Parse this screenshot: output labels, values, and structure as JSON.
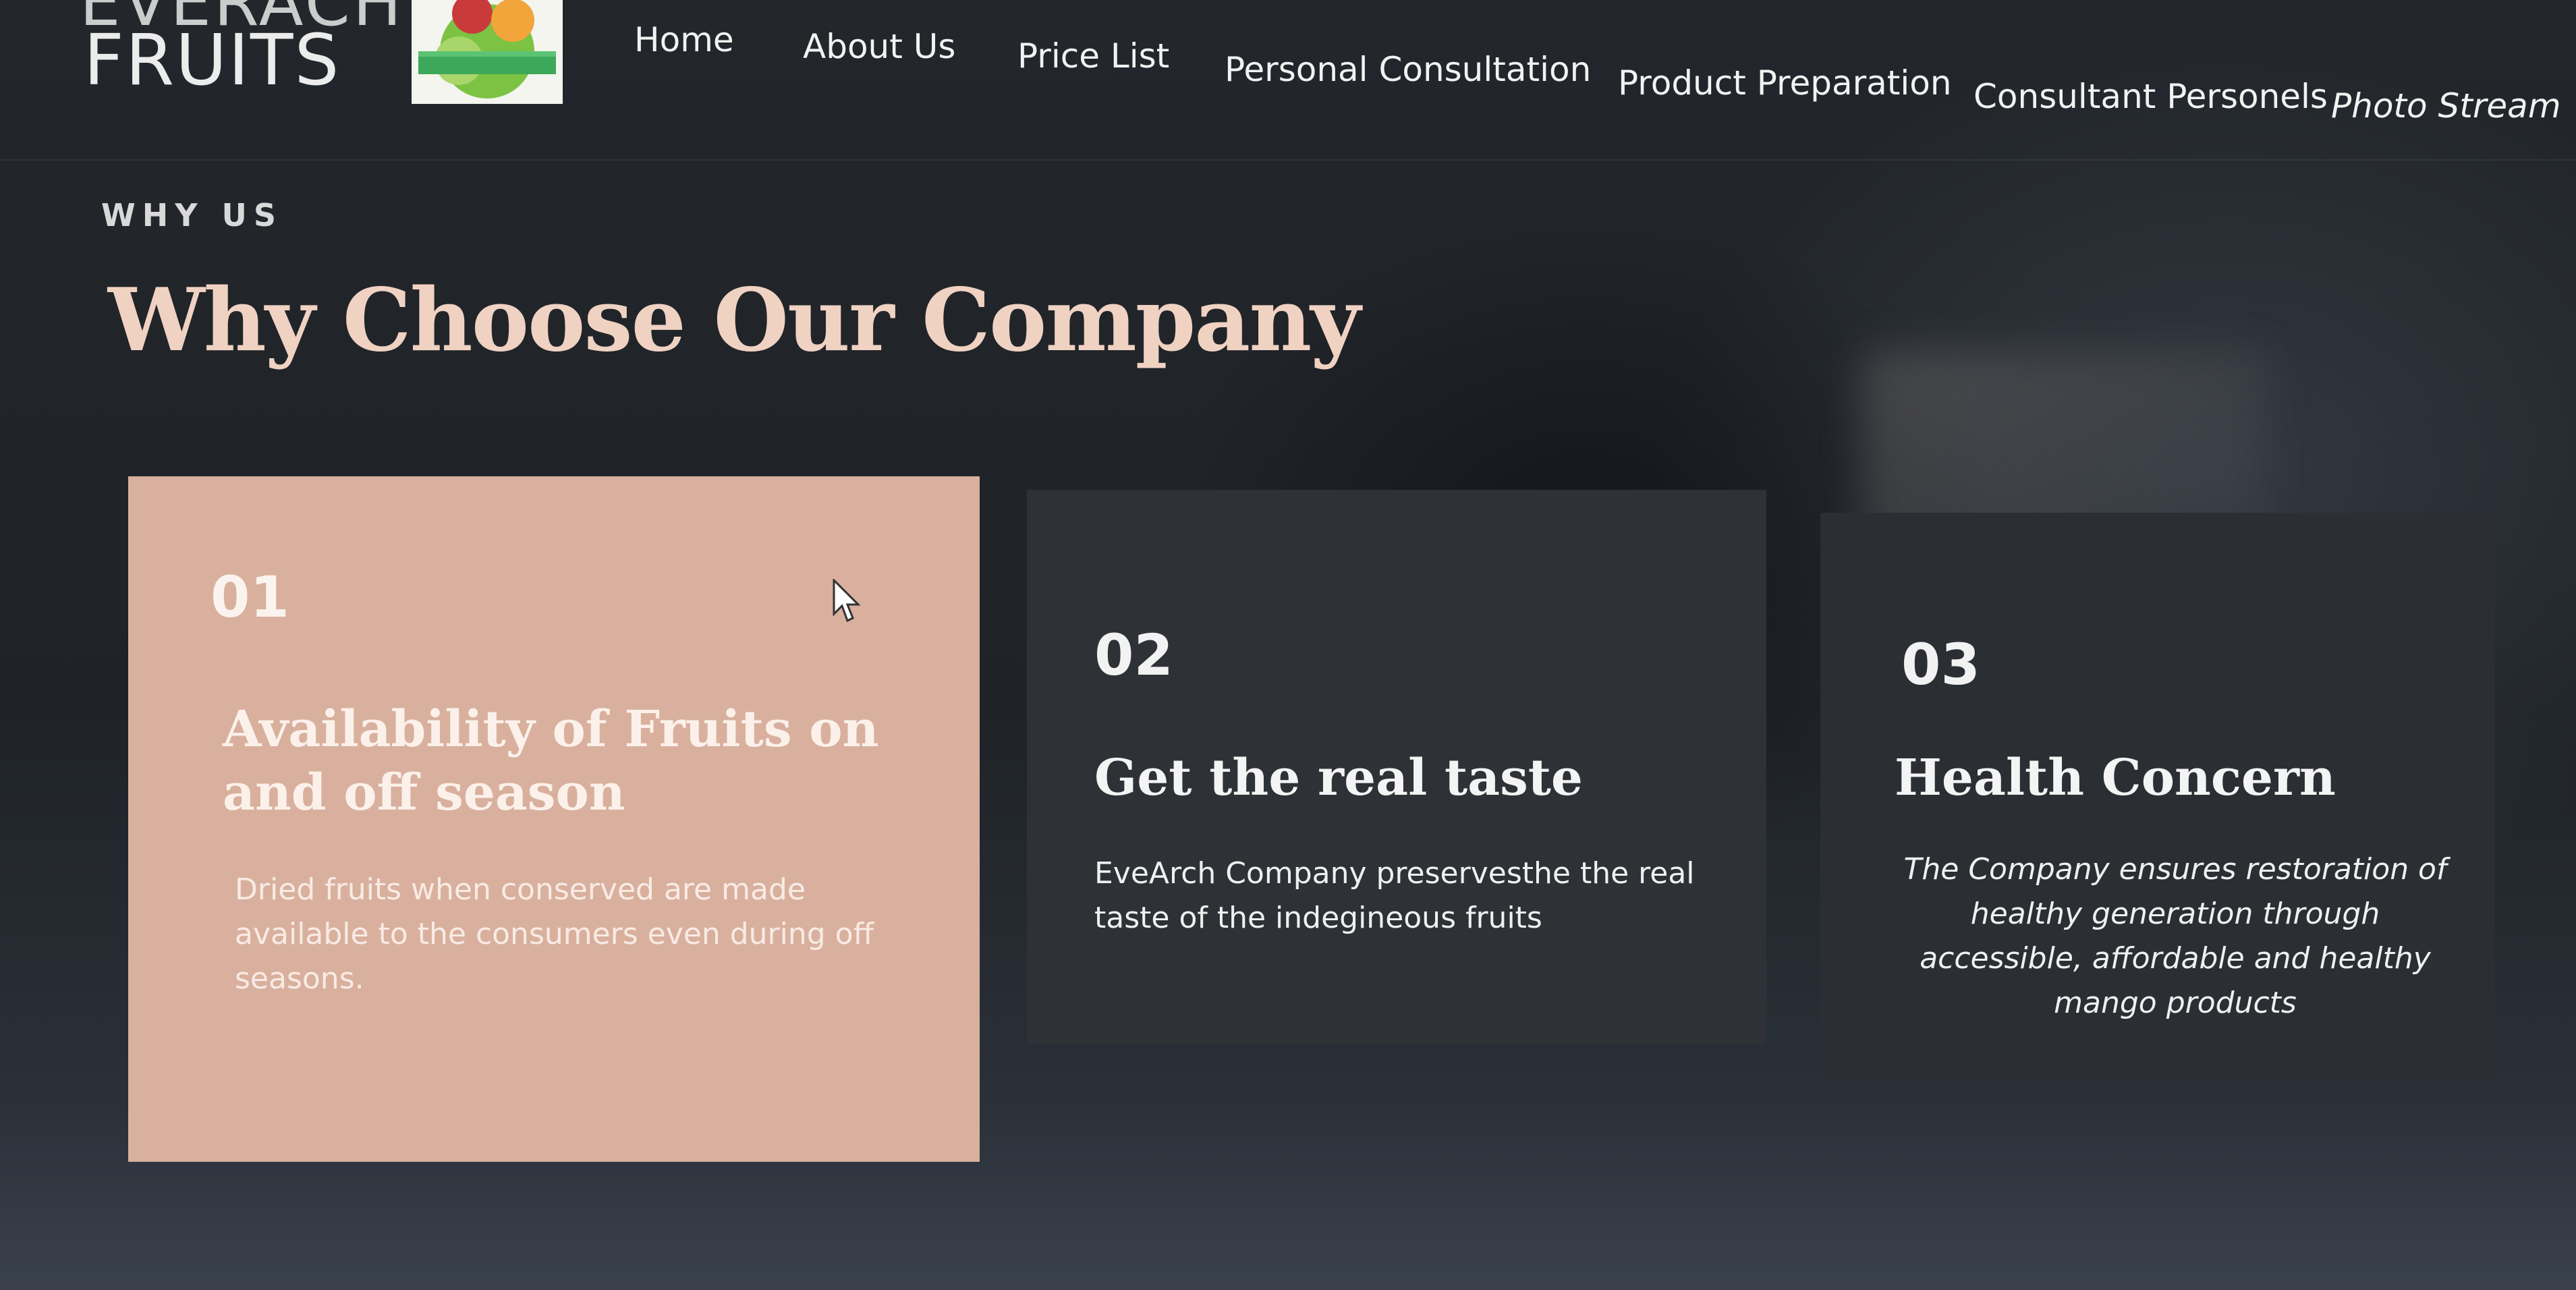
{
  "header": {
    "brand_top": "EVERACH",
    "brand": "FRUITS",
    "nav": [
      {
        "label": "Home"
      },
      {
        "label": "About Us"
      },
      {
        "label": "Price List"
      },
      {
        "label": "Personal Consultation"
      },
      {
        "label": "Product Preparation"
      },
      {
        "label": "Consultant Personels"
      },
      {
        "label": "Photo Stream"
      }
    ]
  },
  "section": {
    "eyebrow": "WHY US",
    "title": "Why Choose Our Company"
  },
  "cards": [
    {
      "number": "01",
      "heading": "Availability of Fruits on and off season",
      "description": "Dried fruits when conserved are made available to the consumers even during off seasons."
    },
    {
      "number": "02",
      "heading": "Get the real taste",
      "description": "EveArch Company preservesthe the real taste of the indegineous fruits"
    },
    {
      "number": "03",
      "heading": "Health Concern",
      "description": "The Company ensures restoration of healthy generation through accessible, affordable and healthy mango products"
    }
  ],
  "colors": {
    "accent": "#f0d2c2",
    "card_highlight": "#d9b09e",
    "card_dark": "#2e3236",
    "background": "#1e2227"
  }
}
